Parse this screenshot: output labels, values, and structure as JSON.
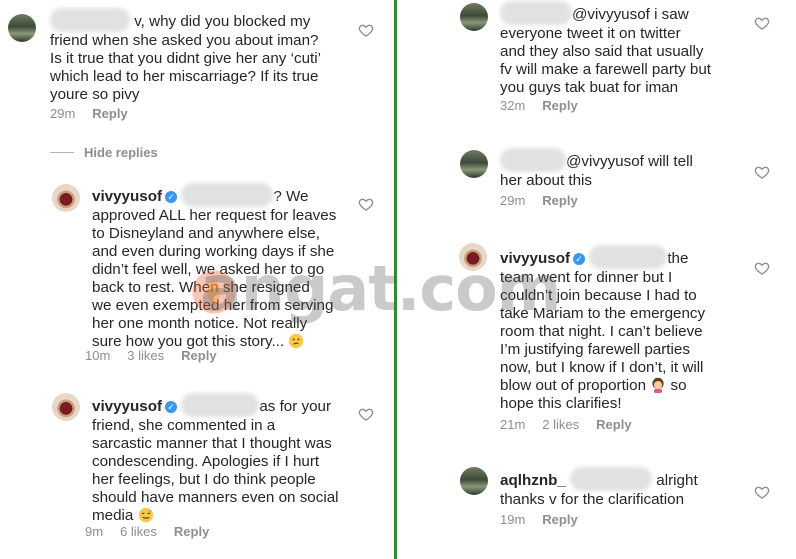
{
  "left": {
    "comments": [
      {
        "lines": [
          " v, why did you blocked my",
          "friend when she asked you about iman?",
          "Is it true that you didnt give her any ‘cuti’",
          "which lead to her miscarriage? If its true",
          "youre so pivy"
        ],
        "time": "29m",
        "reply": "Reply"
      },
      {
        "hide_replies": "Hide replies"
      },
      {
        "user": "vivyyusof",
        "lines": [
          "? We",
          "approved ALL her request for leaves",
          "to Disneyland and anywhere else,",
          "and even during working days if she",
          "didn’t feel well, we asked her to go",
          "back to rest. When she resigned",
          "we even exempted her from serving",
          "her one month notice. Not really",
          "sure how you got this story..."
        ],
        "time": "10m",
        "likes": "3 likes",
        "reply": "Reply"
      },
      {
        "user": "vivyyusof",
        "lines": [
          "as for your",
          "friend, she commented in a",
          "sarcastic manner that I thought was",
          "condescending. Apologies if I hurt",
          "her feelings, but I do think people",
          "should have manners even on social",
          "media"
        ],
        "time": "9m",
        "likes": "6 likes",
        "reply": "Reply"
      }
    ]
  },
  "right": {
    "comments": [
      {
        "lines": [
          "@vivyyusof i saw",
          "everyone tweet it on twitter",
          "and they also said that usually",
          "fv will make a farewell party but",
          "you guys tak buat for iman"
        ],
        "time": "32m",
        "reply": "Reply"
      },
      {
        "lines": [
          "@vivyyusof will tell",
          "her about this"
        ],
        "time": "29m",
        "reply": "Reply"
      },
      {
        "user": "vivyyusof",
        "lines": [
          "the",
          "team went for dinner but I",
          "couldn’t join because I had to",
          "take Mariam to the emergency",
          "room that night. I can’t believe",
          "I’m justifying farewell parties",
          "now, but I know if I don’t, it will",
          "blow out of proportion",
          "so",
          "hope this clarifies!"
        ],
        "time": "21m",
        "likes": "2 likes",
        "reply": "Reply"
      },
      {
        "user": "aqlhznb_",
        "lines": [
          "alright",
          "thanks v for the clarification"
        ],
        "time": "19m",
        "reply": "Reply"
      }
    ]
  },
  "watermark": "angat.com",
  "icons": [
    "heart-icon",
    "verified-badge-icon",
    "thinking-emoji-icon",
    "sweat-smile-emoji-icon",
    "woman-facepalm-emoji-icon"
  ],
  "colors": {
    "divider": "#2e8b3e",
    "meta": "#8e8e8e",
    "text": "#262626",
    "verified": "#3897f0"
  }
}
